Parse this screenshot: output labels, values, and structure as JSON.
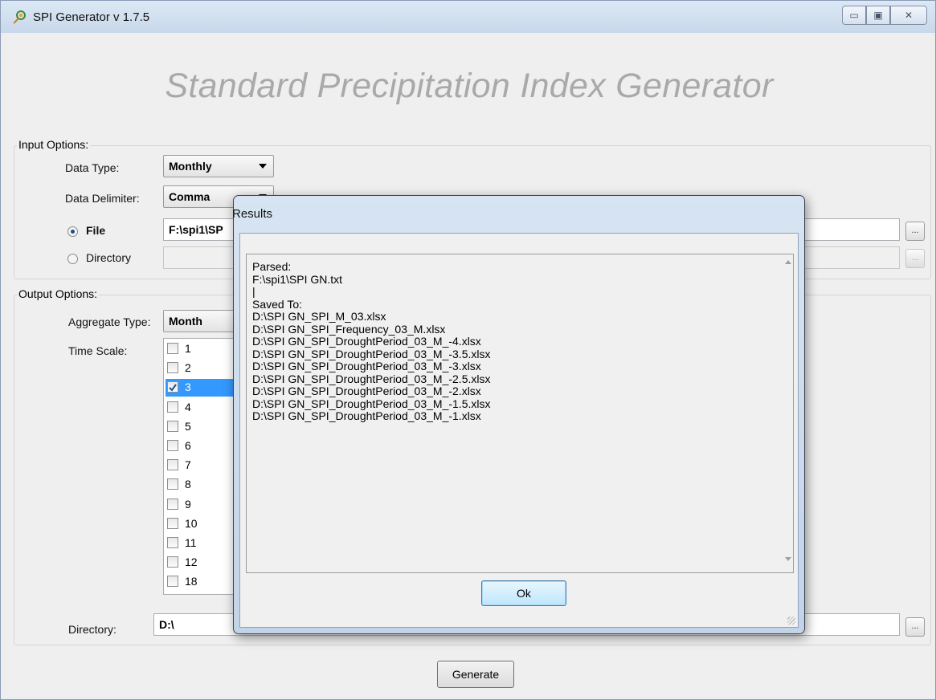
{
  "window": {
    "title": "SPI Generator  v 1.7.5",
    "controls": [
      "minimize",
      "maximize",
      "close"
    ]
  },
  "heading": "Standard Precipitation Index Generator",
  "input_options": {
    "group_label": "Input Options:",
    "data_type_label": "Data Type:",
    "data_type_value": "Monthly",
    "delimiter_label": "Data Delimiter:",
    "delimiter_value": "Comma",
    "file_label": "File",
    "file_value": "F:\\spi1\\SP",
    "directory_label": "Directory",
    "directory_value": "",
    "browse_label": "..."
  },
  "output_options": {
    "group_label": "Output Options:",
    "aggregate_label": "Aggregate Type:",
    "aggregate_value": "Month",
    "timescale_label": "Time Scale:",
    "timescales": [
      {
        "label": "1",
        "checked": false
      },
      {
        "label": "2",
        "checked": false
      },
      {
        "label": "3",
        "checked": true
      },
      {
        "label": "4",
        "checked": false
      },
      {
        "label": "5",
        "checked": false
      },
      {
        "label": "6",
        "checked": false
      },
      {
        "label": "7",
        "checked": false
      },
      {
        "label": "8",
        "checked": false
      },
      {
        "label": "9",
        "checked": false
      },
      {
        "label": "10",
        "checked": false
      },
      {
        "label": "11",
        "checked": false
      },
      {
        "label": "12",
        "checked": false
      },
      {
        "label": "18",
        "checked": false
      }
    ],
    "directory_label": "Directory:",
    "directory_value": "D:\\",
    "browse_label": "..."
  },
  "generate_label": "Generate",
  "dialog": {
    "title": "Results",
    "text": "Parsed:\nF:\\spi1\\SPI GN.txt\n|\nSaved To:\nD:\\SPI GN_SPI_M_03.xlsx\nD:\\SPI GN_SPI_Frequency_03_M.xlsx\nD:\\SPI GN_SPI_DroughtPeriod_03_M_-4.xlsx\nD:\\SPI GN_SPI_DroughtPeriod_03_M_-3.5.xlsx\nD:\\SPI GN_SPI_DroughtPeriod_03_M_-3.xlsx\nD:\\SPI GN_SPI_DroughtPeriod_03_M_-2.5.xlsx\nD:\\SPI GN_SPI_DroughtPeriod_03_M_-2.xlsx\nD:\\SPI GN_SPI_DroughtPeriod_03_M_-1.5.xlsx\nD:\\SPI GN_SPI_DroughtPeriod_03_M_-1.xlsx",
    "ok_label": "Ok"
  }
}
